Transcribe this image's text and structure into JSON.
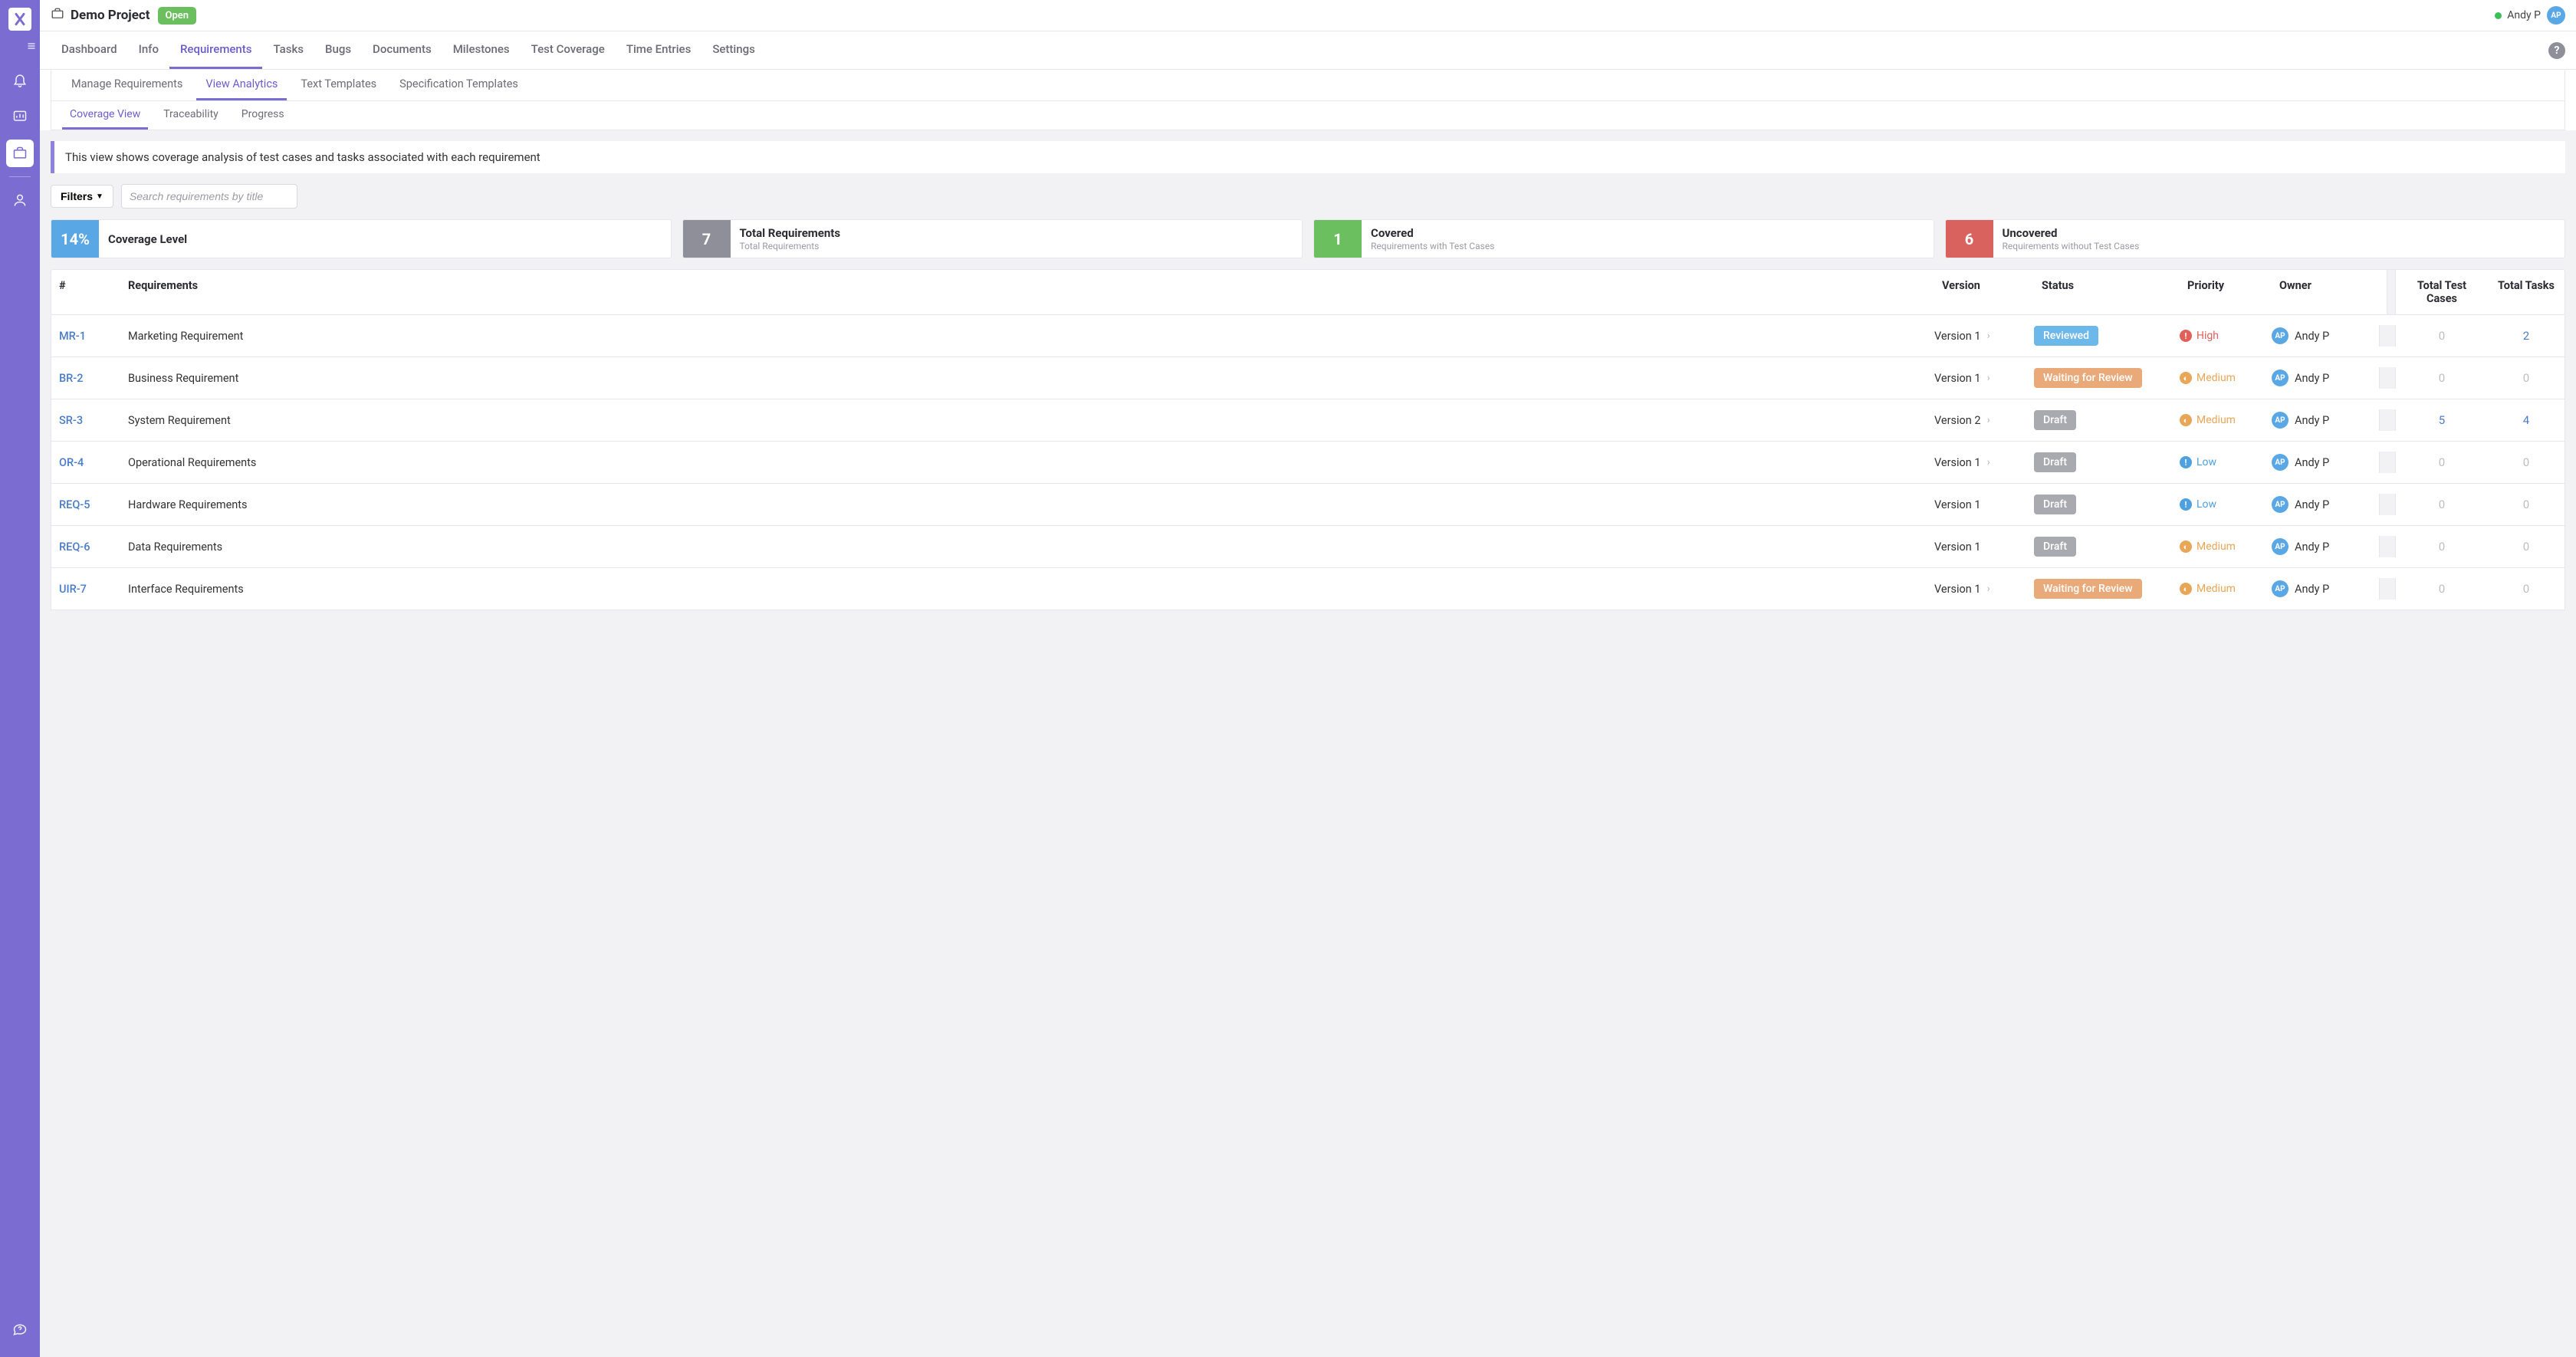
{
  "sidebar": {
    "items": [
      {
        "name": "notifications",
        "active": false
      },
      {
        "name": "dashboard",
        "active": false
      },
      {
        "name": "projects",
        "active": true
      },
      {
        "name": "people",
        "active": false
      }
    ],
    "bottom": {
      "name": "support"
    }
  },
  "header": {
    "project_title": "Demo Project",
    "status_label": "Open",
    "user_name": "Andy P",
    "user_initials": "AP"
  },
  "nav": {
    "items": [
      "Dashboard",
      "Info",
      "Requirements",
      "Tasks",
      "Bugs",
      "Documents",
      "Milestones",
      "Test Coverage",
      "Time Entries",
      "Settings"
    ],
    "active": "Requirements"
  },
  "subnav1": {
    "items": [
      "Manage Requirements",
      "View Analytics",
      "Text Templates",
      "Specification Templates"
    ],
    "active": "View Analytics"
  },
  "subnav2": {
    "items": [
      "Coverage View",
      "Traceability",
      "Progress"
    ],
    "active": "Coverage View"
  },
  "banner": "This view shows coverage analysis of test cases and tasks associated with each requirement",
  "toolbar": {
    "filters_label": "Filters",
    "search_placeholder": "Search requirements by title"
  },
  "stats": {
    "coverage": {
      "value": "14%",
      "title": "Coverage Level"
    },
    "total": {
      "value": "7",
      "title": "Total Requirements",
      "sub": "Total Requirements"
    },
    "covered": {
      "value": "1",
      "title": "Covered",
      "sub": "Requirements with Test Cases"
    },
    "uncovered": {
      "value": "6",
      "title": "Uncovered",
      "sub": "Requirements without Test Cases"
    }
  },
  "table": {
    "headers": {
      "id": "#",
      "req": "Requirements",
      "ver": "Version",
      "status": "Status",
      "pri": "Priority",
      "owner": "Owner",
      "tc": "Total Test Cases",
      "tasks": "Total Tasks"
    },
    "rows": [
      {
        "id": "MR-1",
        "title": "Marketing Requirement",
        "version": "Version 1",
        "has_more": true,
        "status": "Reviewed",
        "status_kind": "reviewed",
        "priority": "High",
        "priority_kind": "high",
        "owner": "Andy P",
        "owner_initials": "AP",
        "test_cases": "0",
        "tc_link": false,
        "tasks": "2",
        "tasks_link": true
      },
      {
        "id": "BR-2",
        "title": "Business Requirement",
        "version": "Version 1",
        "has_more": true,
        "status": "Waiting for Review",
        "status_kind": "waiting",
        "priority": "Medium",
        "priority_kind": "medium",
        "owner": "Andy P",
        "owner_initials": "AP",
        "test_cases": "0",
        "tc_link": false,
        "tasks": "0",
        "tasks_link": false
      },
      {
        "id": "SR-3",
        "title": "System Requirement",
        "version": "Version 2",
        "has_more": true,
        "status": "Draft",
        "status_kind": "draft",
        "priority": "Medium",
        "priority_kind": "medium",
        "owner": "Andy P",
        "owner_initials": "AP",
        "test_cases": "5",
        "tc_link": true,
        "tasks": "4",
        "tasks_link": true
      },
      {
        "id": "OR-4",
        "title": "Operational Requirements",
        "version": "Version 1",
        "has_more": true,
        "status": "Draft",
        "status_kind": "draft",
        "priority": "Low",
        "priority_kind": "low",
        "owner": "Andy P",
        "owner_initials": "AP",
        "test_cases": "0",
        "tc_link": false,
        "tasks": "0",
        "tasks_link": false
      },
      {
        "id": "REQ-5",
        "title": "Hardware Requirements",
        "version": "Version 1",
        "has_more": false,
        "status": "Draft",
        "status_kind": "draft",
        "priority": "Low",
        "priority_kind": "low",
        "owner": "Andy P",
        "owner_initials": "AP",
        "test_cases": "0",
        "tc_link": false,
        "tasks": "0",
        "tasks_link": false
      },
      {
        "id": "REQ-6",
        "title": "Data Requirements",
        "version": "Version 1",
        "has_more": false,
        "status": "Draft",
        "status_kind": "draft",
        "priority": "Medium",
        "priority_kind": "medium",
        "owner": "Andy P",
        "owner_initials": "AP",
        "test_cases": "0",
        "tc_link": false,
        "tasks": "0",
        "tasks_link": false
      },
      {
        "id": "UIR-7",
        "title": "Interface Requirements",
        "version": "Version 1",
        "has_more": true,
        "status": "Waiting for Review",
        "status_kind": "waiting",
        "priority": "Medium",
        "priority_kind": "medium",
        "owner": "Andy P",
        "owner_initials": "AP",
        "test_cases": "0",
        "tc_link": false,
        "tasks": "0",
        "tasks_link": false
      }
    ]
  }
}
